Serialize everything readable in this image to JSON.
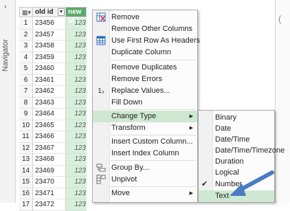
{
  "navigator": {
    "label": "Navigator",
    "chevron": "›"
  },
  "grid": {
    "headers": {
      "old_id": "old id",
      "new_id": "new id"
    },
    "rows": [
      {
        "num": "1",
        "old": "23456",
        "new": "123"
      },
      {
        "num": "2",
        "old": "23457",
        "new": "123"
      },
      {
        "num": "3",
        "old": "23458",
        "new": "123"
      },
      {
        "num": "4",
        "old": "23459",
        "new": "123"
      },
      {
        "num": "5",
        "old": "23460",
        "new": "123"
      },
      {
        "num": "6",
        "old": "23461",
        "new": "123"
      },
      {
        "num": "7",
        "old": "23462",
        "new": "123"
      },
      {
        "num": "8",
        "old": "23463",
        "new": "123"
      },
      {
        "num": "9",
        "old": "23464",
        "new": "123"
      },
      {
        "num": "10",
        "old": "23465",
        "new": "123"
      },
      {
        "num": "11",
        "old": "23466",
        "new": "123"
      },
      {
        "num": "12",
        "old": "23467",
        "new": "123"
      },
      {
        "num": "13",
        "old": "23468",
        "new": "123"
      },
      {
        "num": "14",
        "old": "23469",
        "new": "123"
      },
      {
        "num": "15",
        "old": "23470",
        "new": "123"
      },
      {
        "num": "16",
        "old": "23471",
        "new": "123"
      },
      {
        "num": "17",
        "old": "23472",
        "new": "123"
      }
    ]
  },
  "context_menu": {
    "items": {
      "remove": "Remove",
      "remove_other": "Remove Other Columns",
      "first_row_headers": "Use First Row As Headers",
      "duplicate": "Duplicate Column",
      "remove_duplicates": "Remove Duplicates",
      "remove_errors": "Remove Errors",
      "replace_values": "Replace Values...",
      "fill_down": "Fill Down",
      "change_type": "Change Type",
      "transform": "Transform",
      "insert_custom": "Insert Custom Column...",
      "insert_index": "Insert Index Column",
      "group_by": "Group By...",
      "unpivot": "Unpivot",
      "move": "Move"
    },
    "replace_icon_text": "1₂"
  },
  "submenu": {
    "items": {
      "binary": "Binary",
      "date": "Date",
      "datetime": "Date/Time",
      "datetimezone": "Date/Time/Timezone",
      "duration": "Duration",
      "logical": "Logical",
      "number": "Number",
      "text": "Text"
    },
    "checked": "Number",
    "check_glyph": "✔"
  },
  "colors": {
    "accent_green": "#5da86c",
    "highlight": "#cfe8d2",
    "annotation_arrow": "#4a7bc4"
  }
}
